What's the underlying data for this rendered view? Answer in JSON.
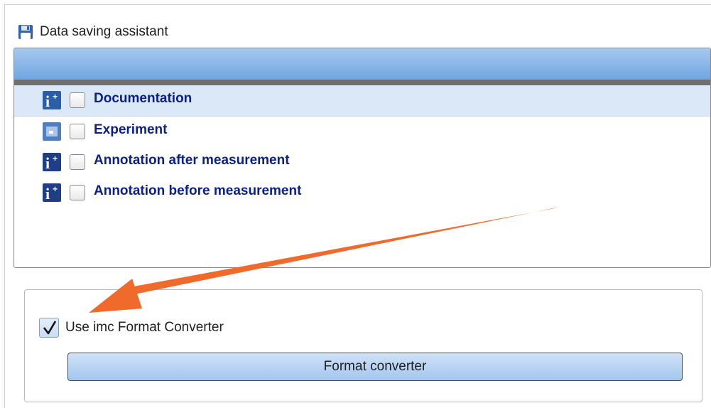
{
  "window": {
    "title": "Data saving assistant",
    "title_icon": "floppy-disk-icon"
  },
  "tree": {
    "items": [
      {
        "label": "Documentation",
        "icon": "info-plus-icon",
        "checked": false,
        "selected": true
      },
      {
        "label": "Experiment",
        "icon": "experiment-icon",
        "checked": false,
        "selected": false
      },
      {
        "label": "Annotation after measurement",
        "icon": "info-plus-icon",
        "checked": false,
        "selected": false
      },
      {
        "label": "Annotation before measurement",
        "icon": "info-plus-icon",
        "checked": false,
        "selected": false
      }
    ]
  },
  "options": {
    "use_converter_label": "Use imc Format Converter",
    "use_converter_checked": true,
    "converter_button_label": "Format converter"
  },
  "colors": {
    "accent": "#6ea6e2",
    "label_text": "#0b1f8a",
    "annotation_arrow": "#f06a2c"
  }
}
